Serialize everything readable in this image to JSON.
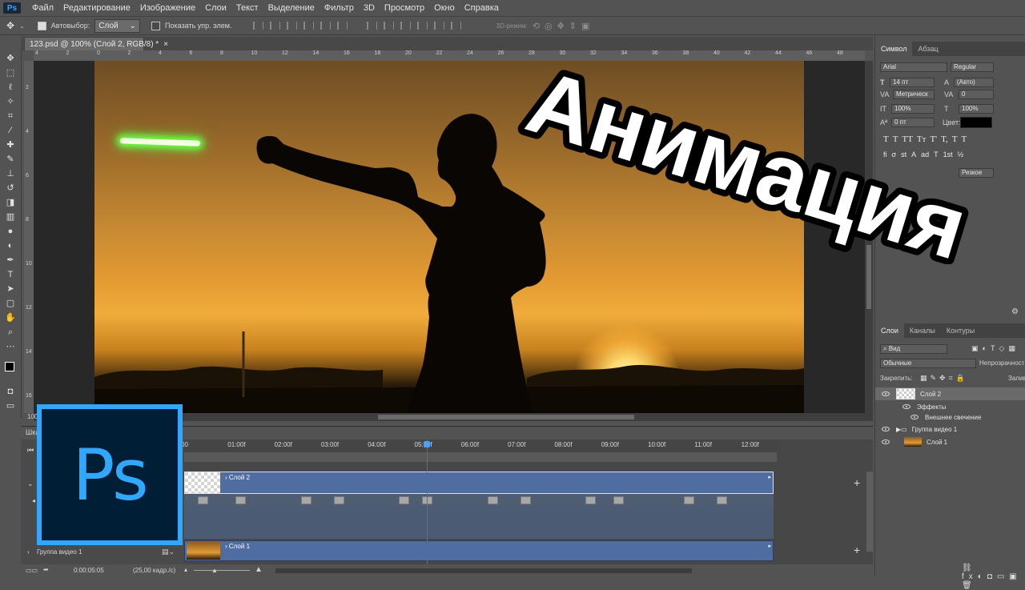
{
  "app": {
    "logo": "Ps"
  },
  "menu": [
    "Файл",
    "Редактирование",
    "Изображение",
    "Слои",
    "Текст",
    "Выделение",
    "Фильтр",
    "3D",
    "Просмотр",
    "Окно",
    "Справка"
  ],
  "options": {
    "autoselect_label": "Автовыбор:",
    "autoselect_value": "Слой",
    "show_transform_label": "Показать упр. элем.",
    "mode_3d_label": "3D-режим:"
  },
  "document": {
    "tab_title": "123.psd @ 100% (Слой 2, RGB/8) *",
    "zoom": "100%"
  },
  "ruler_top": [
    "4",
    "2",
    "0",
    "2",
    "4",
    "6",
    "8",
    "10",
    "12",
    "14",
    "16",
    "18",
    "20",
    "22",
    "24",
    "26",
    "28",
    "30",
    "32",
    "34",
    "36",
    "38",
    "40",
    "42",
    "44",
    "46",
    "48"
  ],
  "ruler_left": [
    "2",
    "4",
    "6",
    "8",
    "10",
    "12",
    "14",
    "16"
  ],
  "overlay_title": "Анимация",
  "character_panel": {
    "tabs": [
      "Символ",
      "Абзац"
    ],
    "font_family": "Arial",
    "font_style": "Regular",
    "font_size": "14 пт",
    "leading": "(Авто)",
    "kerning": "Метрическ",
    "tracking": "0",
    "vertical_scale": "100%",
    "horizontal_scale": "100%",
    "baseline_shift": "0 пт",
    "color_label": "Цвет:",
    "color": "#000000",
    "text_buttons": [
      "T",
      "T",
      "TT",
      "Tт",
      "T'",
      "T,",
      "T",
      "T"
    ],
    "glyph_buttons": [
      "fi",
      "σ",
      "st",
      "A",
      "ad",
      "T",
      "1st",
      "½"
    ],
    "antialias_label": "Резкое"
  },
  "layers_panel": {
    "tabs": [
      "Слои",
      "Каналы",
      "Контуры"
    ],
    "filter": "Вид",
    "blend_mode": "Обычные",
    "opacity_label": "Непрозрачност",
    "lock_label": "Закрепить:",
    "fill_label": "Залив",
    "layers": [
      {
        "name": "Слой 2",
        "kind": "layer"
      },
      {
        "name": "Эффекты",
        "kind": "effects"
      },
      {
        "name": "Внешнее свечение",
        "kind": "effect"
      },
      {
        "name": "Группа видео 1",
        "kind": "group"
      },
      {
        "name": "Слой 1",
        "kind": "layer"
      }
    ]
  },
  "timeline": {
    "panel_title": "Шкала",
    "ruler": [
      "00",
      "01:00f",
      "02:00f",
      "03:00f",
      "04:00f",
      "05:00f",
      "06:00f",
      "07:00f",
      "08:00f",
      "09:00f",
      "10:00f",
      "11:00f",
      "12:00f"
    ],
    "tracks": [
      {
        "name": "Слой 2"
      },
      {
        "name": "Слой 1"
      }
    ],
    "group_label": "Группа видео 1",
    "current_time": "0:00:05:05",
    "fps": "(25,00 кадр./с)",
    "playhead_seconds": 5.2,
    "keyframe_seconds": [
      0.3,
      1.1,
      2.5,
      3.2,
      4.6,
      5.1,
      6.5,
      7.2,
      8.6,
      9.2,
      10.7,
      11.4
    ]
  },
  "colors": {
    "accent": "#31a8ff",
    "ps_bg": "#001e36",
    "track": "#4f6da1",
    "playhead": "#e43c2c",
    "glow": "#6dff48"
  }
}
